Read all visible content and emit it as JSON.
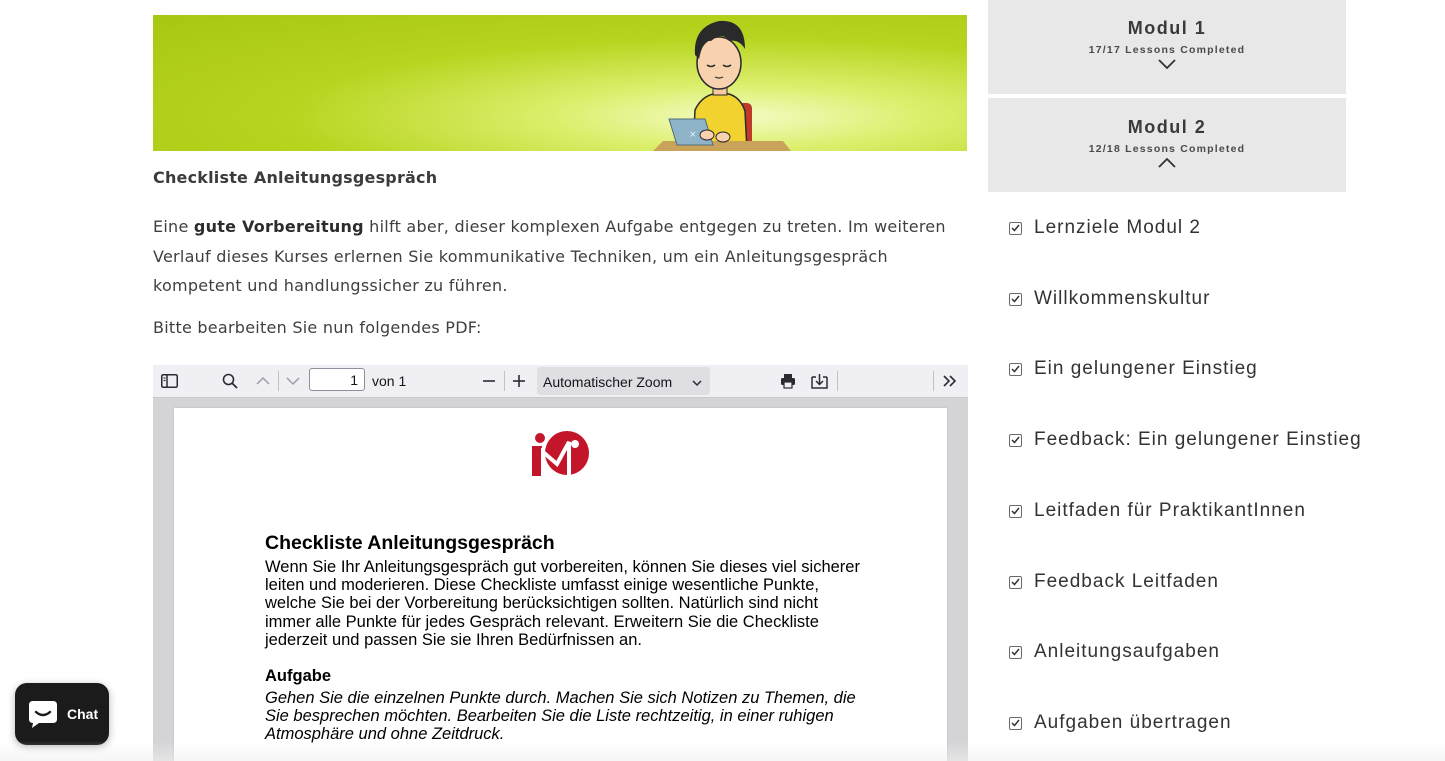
{
  "article": {
    "heading": "Checkliste Anleitungsgespräch",
    "para_start": "Eine ",
    "para_bold": "gute Vorbereitung",
    "para_end": " hilft aber, dieser komplexen Aufgabe entgegen zu treten. Im weiteren Verlauf dieses Kurses erlernen Sie kommunikative Techniken, um ein Anleitungsgespräch kompetent und handlungssicher zu führen.",
    "note": "Bitte bearbeiten Sie nun folgendes PDF:"
  },
  "pdf_viewer": {
    "toolbar": {
      "sidebar_toggle_icon": "sidebar-icon",
      "search_icon": "search-icon",
      "page_value": "1",
      "page_total": "von 1",
      "zoom_value": "Automatischer Zoom",
      "print_icon": "print-icon",
      "download_icon": "save-icon",
      "more_icon": "double-chevron-right-icon"
    },
    "page": {
      "title": "Checkliste Anleitungsgespräch",
      "intro": "Wenn Sie Ihr Anleitungsgespräch gut vorbereiten, können Sie dieses viel sicherer leiten und moderieren. Diese Checkliste umfasst einige wesentliche Punkte, welche Sie bei der Vorbereitung berücksichtigen sollten. Natürlich sind nicht immer alle Punkte für jedes Gespräch relevant. Erweitern Sie die Checkliste jederzeit und passen Sie sie Ihren Bedürfnissen an.",
      "task_label": "Aufgabe",
      "task_text": "Gehen Sie die einzelnen Punkte durch. Machen Sie sich Notizen zu Themen, die Sie besprechen möchten. Bearbeiten Sie die Liste rechtzeitig, in einer ruhigen Atmosphäre und ohne Zeitdruck."
    }
  },
  "sidebar": {
    "modules": [
      {
        "title": "Modul 1",
        "progress": "17/17 Lessons Completed",
        "expanded": false
      },
      {
        "title": "Modul 2",
        "progress": "12/18 Lessons Completed",
        "expanded": true
      }
    ],
    "lessons": [
      {
        "label": "Lernziele Modul 2",
        "checked": true
      },
      {
        "label": "Willkommenskultur",
        "checked": true
      },
      {
        "label": "Ein gelungener Einstieg",
        "checked": true
      },
      {
        "label": "Feedback: Ein gelungener Einstieg",
        "checked": true
      },
      {
        "label": "Leitfaden für PraktikantInnen",
        "checked": true
      },
      {
        "label": "Feedback Leitfaden",
        "checked": true
      },
      {
        "label": "Anleitungsaufgaben",
        "checked": true
      },
      {
        "label": "Aufgaben übertragen",
        "checked": true
      }
    ]
  },
  "chat": {
    "label": "Chat",
    "icon": "chat-bubble-icon"
  },
  "colors": {
    "banner_green": "#b7d41e",
    "logo_red": "#c4162a",
    "module_bg": "#e8e8e8",
    "chat_bg": "#1b1b1b"
  }
}
